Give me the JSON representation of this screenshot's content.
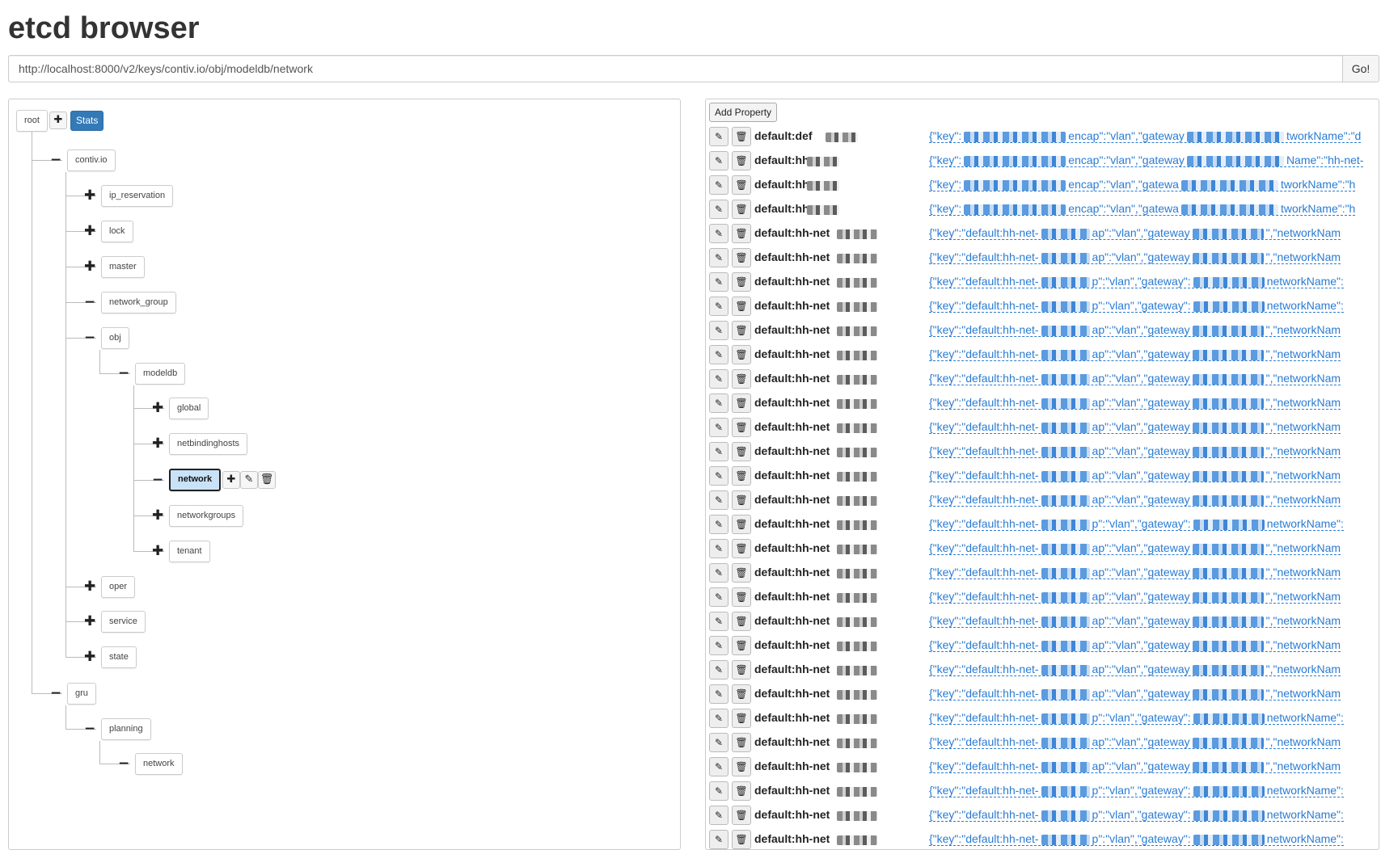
{
  "app": {
    "title": "etcd browser"
  },
  "urlbar": {
    "url": "http://localhost:8000/v2/keys/contiv.io/obj/modeldb/network",
    "go_label": "Go!"
  },
  "tree": {
    "root_label": "root",
    "stats_label": "Stats",
    "nodes": [
      {
        "label": "contiv.io",
        "expanded": true
      },
      {
        "label": "ip_reservation",
        "expanded": false
      },
      {
        "label": "lock",
        "expanded": false
      },
      {
        "label": "master",
        "expanded": false
      },
      {
        "label": "network_group",
        "expanded": true
      },
      {
        "label": "obj",
        "expanded": true
      },
      {
        "label": "modeldb",
        "expanded": true
      },
      {
        "label": "global",
        "expanded": false
      },
      {
        "label": "netbindinghosts",
        "expanded": false
      },
      {
        "label": "network",
        "expanded": true,
        "selected": true
      },
      {
        "label": "networkgroups",
        "expanded": false
      },
      {
        "label": "tenant",
        "expanded": false
      },
      {
        "label": "oper",
        "expanded": false
      },
      {
        "label": "service",
        "expanded": false
      },
      {
        "label": "state",
        "expanded": false
      },
      {
        "label": "gru",
        "expanded": true
      },
      {
        "label": "planning",
        "expanded": true
      },
      {
        "label": "network",
        "expanded": true
      }
    ]
  },
  "properties": {
    "add_label": "Add Property",
    "rows": [
      {
        "key": "default:def",
        "value_start": "{\"key\":",
        "value_mid": "encap\":\"vlan\",\"gateway",
        "value_end": "tworkName\":\"d"
      },
      {
        "key": "default:hh-",
        "value_start": "{\"key\":",
        "value_mid": "encap\":\"vlan\",\"gateway",
        "value_end": "Name\":\"hh-net-"
      },
      {
        "key": "default:hh-",
        "value_start": "{\"key\":",
        "value_mid": "encap\":\"vlan\",\"gatewa",
        "value_end": "tworkName\":\"h"
      },
      {
        "key": "default:hh-",
        "value_start": "{\"key\":",
        "value_mid": "encap\":\"vlan\",\"gatewa",
        "value_end": "tworkName\":\"h"
      },
      {
        "key": "default:hh-net",
        "value_start": "{\"key\":\"default:hh-net-",
        "value_mid": "ap\":\"vlan\",\"gateway",
        "value_end": "\",\"networkNam"
      },
      {
        "key": "default:hh-net",
        "value_start": "{\"key\":\"default:hh-net-",
        "value_mid": "ap\":\"vlan\",\"gateway",
        "value_end": "\",\"networkNam"
      },
      {
        "key": "default:hh-net",
        "value_start": "{\"key\":\"default:hh-net-",
        "value_mid": "p\":\"vlan\",\"gateway\":",
        "value_end": "networkName\":"
      },
      {
        "key": "default:hh-net",
        "value_start": "{\"key\":\"default:hh-net-",
        "value_mid": "p\":\"vlan\",\"gateway\":",
        "value_end": "networkName\":"
      },
      {
        "key": "default:hh-net",
        "value_start": "{\"key\":\"default:hh-net-",
        "value_mid": "ap\":\"vlan\",\"gateway",
        "value_end": "\",\"networkNam"
      },
      {
        "key": "default:hh-net",
        "value_start": "{\"key\":\"default:hh-net-",
        "value_mid": "ap\":\"vlan\",\"gateway",
        "value_end": "\",\"networkNam"
      },
      {
        "key": "default:hh-net",
        "value_start": "{\"key\":\"default:hh-net-",
        "value_mid": "ap\":\"vlan\",\"gateway",
        "value_end": "\",\"networkNam"
      },
      {
        "key": "default:hh-net",
        "value_start": "{\"key\":\"default:hh-net-",
        "value_mid": "ap\":\"vlan\",\"gateway",
        "value_end": "\",\"networkNam"
      },
      {
        "key": "default:hh-net",
        "value_start": "{\"key\":\"default:hh-net-",
        "value_mid": "ap\":\"vlan\",\"gateway",
        "value_end": "\",\"networkNam"
      },
      {
        "key": "default:hh-net",
        "value_start": "{\"key\":\"default:hh-net-",
        "value_mid": "ap\":\"vlan\",\"gateway",
        "value_end": "\",\"networkNam"
      },
      {
        "key": "default:hh-net",
        "value_start": "{\"key\":\"default:hh-net-",
        "value_mid": "ap\":\"vlan\",\"gateway",
        "value_end": "\",\"networkNam"
      },
      {
        "key": "default:hh-net",
        "value_start": "{\"key\":\"default:hh-net-",
        "value_mid": "ap\":\"vlan\",\"gateway",
        "value_end": "\",\"networkNam"
      },
      {
        "key": "default:hh-net",
        "value_start": "{\"key\":\"default:hh-net-",
        "value_mid": "p\":\"vlan\",\"gateway\":",
        "value_end": "networkName\":"
      },
      {
        "key": "default:hh-net",
        "value_start": "{\"key\":\"default:hh-net-",
        "value_mid": "ap\":\"vlan\",\"gateway",
        "value_end": "\",\"networkNam"
      },
      {
        "key": "default:hh-net",
        "value_start": "{\"key\":\"default:hh-net-",
        "value_mid": "ap\":\"vlan\",\"gateway",
        "value_end": "\",\"networkNam"
      },
      {
        "key": "default:hh-net",
        "value_start": "{\"key\":\"default:hh-net-",
        "value_mid": "ap\":\"vlan\",\"gateway",
        "value_end": "\",\"networkNam"
      },
      {
        "key": "default:hh-net",
        "value_start": "{\"key\":\"default:hh-net-",
        "value_mid": "ap\":\"vlan\",\"gateway",
        "value_end": "\",\"networkNam"
      },
      {
        "key": "default:hh-net",
        "value_start": "{\"key\":\"default:hh-net-",
        "value_mid": "ap\":\"vlan\",\"gateway",
        "value_end": "\",\"networkNam"
      },
      {
        "key": "default:hh-net",
        "value_start": "{\"key\":\"default:hh-net-",
        "value_mid": "ap\":\"vlan\",\"gateway",
        "value_end": "\",\"networkNam"
      },
      {
        "key": "default:hh-net",
        "value_start": "{\"key\":\"default:hh-net-",
        "value_mid": "ap\":\"vlan\",\"gateway",
        "value_end": "\",\"networkNam"
      },
      {
        "key": "default:hh-net",
        "value_start": "{\"key\":\"default:hh-net-",
        "value_mid": "p\":\"vlan\",\"gateway\":",
        "value_end": "networkName\":"
      },
      {
        "key": "default:hh-net",
        "value_start": "{\"key\":\"default:hh-net-",
        "value_mid": "ap\":\"vlan\",\"gateway",
        "value_end": "\",\"networkNam"
      },
      {
        "key": "default:hh-net",
        "value_start": "{\"key\":\"default:hh-net-",
        "value_mid": "ap\":\"vlan\",\"gateway",
        "value_end": "\",\"networkNam"
      },
      {
        "key": "default:hh-net",
        "value_start": "{\"key\":\"default:hh-net-",
        "value_mid": "p\":\"vlan\",\"gateway\":",
        "value_end": "networkName\":"
      },
      {
        "key": "default:hh-net",
        "value_start": "{\"key\":\"default:hh-net-",
        "value_mid": "p\":\"vlan\",\"gateway\":",
        "value_end": "networkName\":"
      },
      {
        "key": "default:hh-net",
        "value_start": "{\"key\":\"default:hh-net-",
        "value_mid": "p\":\"vlan\",\"gateway\":",
        "value_end": "networkName\":"
      }
    ]
  },
  "icons": {
    "expand": "plus-icon",
    "collapse": "minus-icon",
    "edit": "edit-icon",
    "delete": "trash-icon"
  },
  "colors": {
    "link": "#2a7bd2",
    "selected": "#c9e2f7",
    "stats": "#337ab7"
  }
}
